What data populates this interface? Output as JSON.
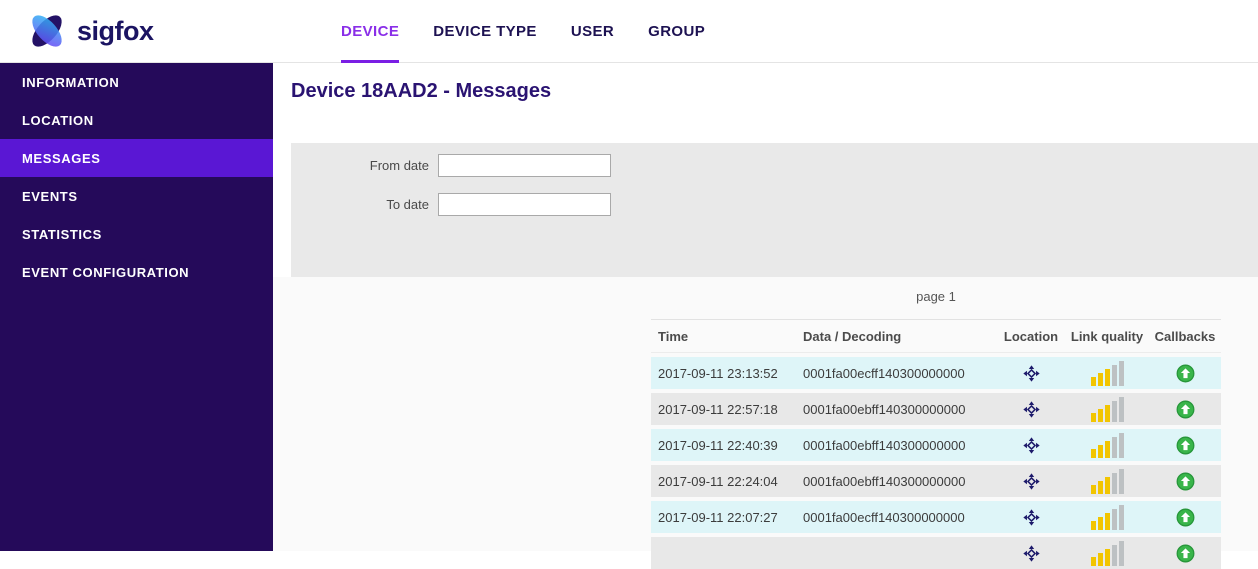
{
  "brand": {
    "name": "sigfox",
    "logo_icon": "butterfly-logo"
  },
  "nav": {
    "tabs": [
      {
        "label": "DEVICE",
        "active": true
      },
      {
        "label": "DEVICE TYPE",
        "active": false
      },
      {
        "label": "USER",
        "active": false
      },
      {
        "label": "GROUP",
        "active": false
      }
    ]
  },
  "sidebar": {
    "items": [
      {
        "label": "INFORMATION",
        "active": false
      },
      {
        "label": "LOCATION",
        "active": false
      },
      {
        "label": "MESSAGES",
        "active": true
      },
      {
        "label": "EVENTS",
        "active": false
      },
      {
        "label": "STATISTICS",
        "active": false
      },
      {
        "label": "EVENT CONFIGURATION",
        "active": false
      }
    ]
  },
  "page": {
    "title": "Device 18AAD2 - Messages"
  },
  "filters": {
    "from_label": "From date",
    "from_value": "",
    "to_label": "To date",
    "to_value": ""
  },
  "pagination": {
    "label": "page 1"
  },
  "table": {
    "columns": [
      "Time",
      "Data / Decoding",
      "Location",
      "Link quality",
      "Callbacks"
    ],
    "rows": [
      {
        "time": "2017-09-11 23:13:52",
        "data": "0001fa00ecff140300000000",
        "location_icon": "move-crosshair-icon",
        "link_quality": 3,
        "link_quality_total": 5,
        "callback_icon": "uplink-arrow-icon"
      },
      {
        "time": "2017-09-11 22:57:18",
        "data": "0001fa00ebff140300000000",
        "location_icon": "move-crosshair-icon",
        "link_quality": 3,
        "link_quality_total": 5,
        "callback_icon": "uplink-arrow-icon"
      },
      {
        "time": "2017-09-11 22:40:39",
        "data": "0001fa00ebff140300000000",
        "location_icon": "move-crosshair-icon",
        "link_quality": 3,
        "link_quality_total": 5,
        "callback_icon": "uplink-arrow-icon"
      },
      {
        "time": "2017-09-11 22:24:04",
        "data": "0001fa00ebff140300000000",
        "location_icon": "move-crosshair-icon",
        "link_quality": 3,
        "link_quality_total": 5,
        "callback_icon": "uplink-arrow-icon"
      },
      {
        "time": "2017-09-11 22:07:27",
        "data": "0001fa00ecff140300000000",
        "location_icon": "move-crosshair-icon",
        "link_quality": 3,
        "link_quality_total": 5,
        "callback_icon": "uplink-arrow-icon"
      },
      {
        "time": "",
        "data": "",
        "location_icon": "move-crosshair-icon",
        "link_quality": 3,
        "link_quality_total": 5,
        "callback_icon": "uplink-arrow-icon"
      }
    ]
  },
  "colors": {
    "sidebar_bg": "#250a5a",
    "sidebar_active_bg": "#5a17d4",
    "nav_active": "#8a2fe8",
    "nav_underline": "#7a1ee4",
    "title_color": "#2a1372",
    "panel_bg": "#e9e9e9",
    "row_cyan": "#def5f8",
    "row_gray": "#e8e8e8",
    "bar_yellow": "#f2c500",
    "bar_gray": "#bdc1c3",
    "callback_green": "#39b54a",
    "location_navy": "#1d1a6b"
  }
}
